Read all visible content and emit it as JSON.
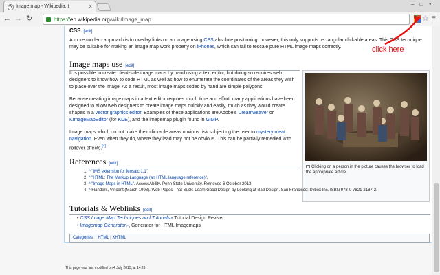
{
  "browser": {
    "tab_title": "Image map - Wikipedia, t",
    "tab_favicon": "W",
    "url_https": "https://",
    "url_domain": "en.wikipedia.org",
    "url_path": "/wiki/Image_map"
  },
  "sections": {
    "css": {
      "heading": "CSS",
      "edit": "[edit]",
      "text_a": "A more modern approach is to overlay links on an image using ",
      "link_css": "CSS",
      "text_b": " absolute positioning; however, this only supports rectangular clickable areas. This CSS technique may be suitable for making an image map work properly on ",
      "link_iphones": "iPhones",
      "text_c": ", which can fail to rescale pure HTML image maps correctly."
    },
    "manual": {
      "heading": "Image maps use",
      "edit": "[edit]",
      "p1": "It is possible to create client-side image maps by hand using a text editor, but doing so requires web designers to know how to code HTML as well as how to enumerate the coordinates of the areas they wish to place over the image. As a result, most image maps coded by hand are simple polygons.",
      "p2_a": "Because creating image maps in a text editor requires much time and effort, many applications have been designed to allow web designers to create image maps quickly and easily, much as they would create shapes in a ",
      "p2_link1": "vector graphics editor",
      "p2_b": ". Examples of these applications are Adobe's ",
      "p2_link2": "Dreamweaver",
      "p2_c": " or ",
      "p2_link3": "KImageMapEditor",
      "p2_d": " (for ",
      "p2_link4": "KDE",
      "p2_e": "), and the imagemap plugin found in ",
      "p2_link5": "GIMP",
      "p2_f": ".",
      "p3_a": "Image maps which do not make their clickable areas obvious risk subjecting the user to ",
      "p3_link": "mystery meat navigation",
      "p3_b": ". Even when they do, where they lead may not be obvious. This can be partially remedied with rollover effects.",
      "p3_ref": "[4]"
    },
    "figure": {
      "caption": "Clicking on a person in the picture causes the browser to load the appropriate article."
    },
    "references": {
      "heading": "References",
      "edit": "[edit]",
      "items": [
        {
          "num": "1.",
          "caret": "^",
          "link": "\"IMS extension for Mosaic 1.1\"",
          "rest": ""
        },
        {
          "num": "2.",
          "caret": "^",
          "link": "\"HTML: The Markup Language (an HTML language reference)\"",
          "rest": "."
        },
        {
          "num": "3.",
          "caret": "^",
          "link": "\"Image Maps in HTML\"",
          "rest": ". AccessAbility. Penn State University. Retrieved 6 October 2013."
        },
        {
          "num": "4.",
          "caret": "^",
          "link": "",
          "rest": "Flanders, Vincent (March 1998). Web Pages That Suck: Learn Good Design by Looking at Bad Design. San Francisco: Sybex Inc. ISBN 978-0-7821-2187-2."
        }
      ]
    },
    "tutorials": {
      "heading": "Tutorials & Weblinks",
      "edit": "[edit]",
      "items": [
        {
          "link": "CSS Image Map Techniques and Tutorials",
          "rest": " Tutorial Design Reviver"
        },
        {
          "link": "Imagemap Generator",
          "rest": ", Generator for HTML Imagemaps"
        }
      ]
    },
    "categories": {
      "label": "Categories:",
      "items": [
        "HTML",
        "XHTML"
      ]
    }
  },
  "footer": "This page was last modified on 4 July 2015, at 14:26.",
  "annotation": {
    "text": "click here",
    "color": "#e8100e"
  }
}
